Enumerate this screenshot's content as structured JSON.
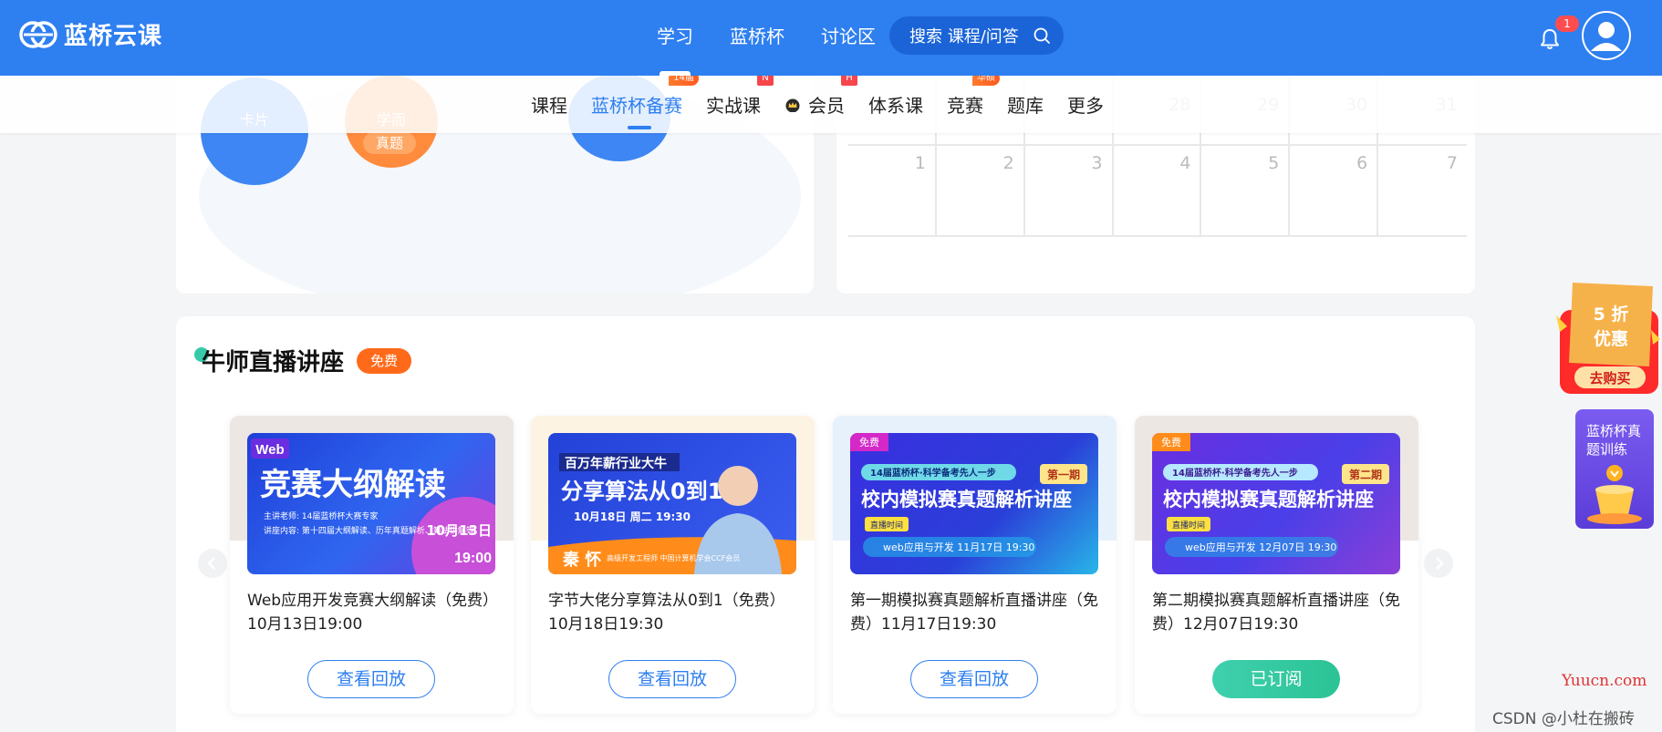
{
  "brand": {
    "name": "蓝桥云课"
  },
  "topnav": {
    "items": [
      {
        "label": "学习",
        "active": true
      },
      {
        "label": "蓝桥杯",
        "active": false
      },
      {
        "label": "讨论区",
        "active": false
      }
    ],
    "search_text": "搜索 课程/问答",
    "notification_count": "1"
  },
  "subnav": {
    "items": [
      {
        "label": "课程",
        "tag": ""
      },
      {
        "label": "蓝桥杯备赛",
        "tag": "14届",
        "active": true
      },
      {
        "label": "实战课",
        "tag": "N"
      },
      {
        "label": "会员",
        "tag": "H"
      },
      {
        "label": "体系课",
        "tag": ""
      },
      {
        "label": "竞赛",
        "tag": "华硕"
      },
      {
        "label": "题库",
        "tag": ""
      },
      {
        "label": "更多",
        "tag": ""
      }
    ]
  },
  "bubbles": {
    "card_label": "卡片",
    "card_sub": "真题",
    "study_label": "学而",
    "study_pill": "真题"
  },
  "calendar": {
    "row1": [
      "",
      "",
      "",
      "28",
      "29",
      "30",
      "31"
    ],
    "row2": [
      "1",
      "2",
      "3",
      "4",
      "5",
      "6",
      "7"
    ]
  },
  "live": {
    "title": "牛师直播讲座",
    "badge": "免费",
    "courses": [
      {
        "thumb_tag": "Web",
        "thumb_headline": "竞赛大纲解读",
        "thumb_line1": "主讲老师: 14届蓝桥杯大赛专家",
        "thumb_line2": "讲座内容: 第十四届大纲解读、历年真题解析、算法讲解等",
        "thumb_date": "10月13日",
        "thumb_time": "19:00",
        "title": "Web应用开发竞赛大纲解读（免费）10月13日19:00",
        "button": "查看回放",
        "subscribed": false
      },
      {
        "thumb_tag": "百万年薪行业大牛",
        "thumb_headline": "分享算法从0到1",
        "thumb_line1": "10月18日 周二 19:30",
        "thumb_name": "秦 怀",
        "thumb_role": "高级开发工程师 中国计算机学会CCF会员",
        "title": "字节大佬分享算法从0到1（免费）10月18日19:30",
        "button": "查看回放",
        "subscribed": false
      },
      {
        "thumb_tag": "免费",
        "thumb_banner": "14届蓝桥杯·科学备考先人一步",
        "thumb_issue": "第一期",
        "thumb_headline": "校内模拟赛真题解析讲座",
        "thumb_live": "直播时间",
        "thumb_line1": "web应用与开发  11月17日 19:30",
        "title": "第一期模拟赛真题解析直播讲座（免费）11月17日19:30",
        "button": "查看回放",
        "subscribed": false
      },
      {
        "thumb_tag": "免费",
        "thumb_banner": "14届蓝桥杯·科学备考先人一步",
        "thumb_issue": "第二期",
        "thumb_headline": "校内模拟赛真题解析讲座",
        "thumb_live": "直播时间",
        "thumb_line1": "web应用与开发  12月07日 19:30",
        "title": "第二期模拟赛真题解析直播讲座（免费）12月07日19:30",
        "button": "已订阅",
        "subscribed": true
      }
    ]
  },
  "promo": {
    "line1": "5 折",
    "line2": "优惠",
    "button": "去购买"
  },
  "training": {
    "label": "蓝桥杯真题训练"
  },
  "watermark": {
    "site": "Yuucn.com",
    "csdn": "CSDN @小杜在搬砖"
  },
  "colors": {
    "primary": "#2e7ff0",
    "orange": "#ff6a1a",
    "green": "#2bc395"
  }
}
